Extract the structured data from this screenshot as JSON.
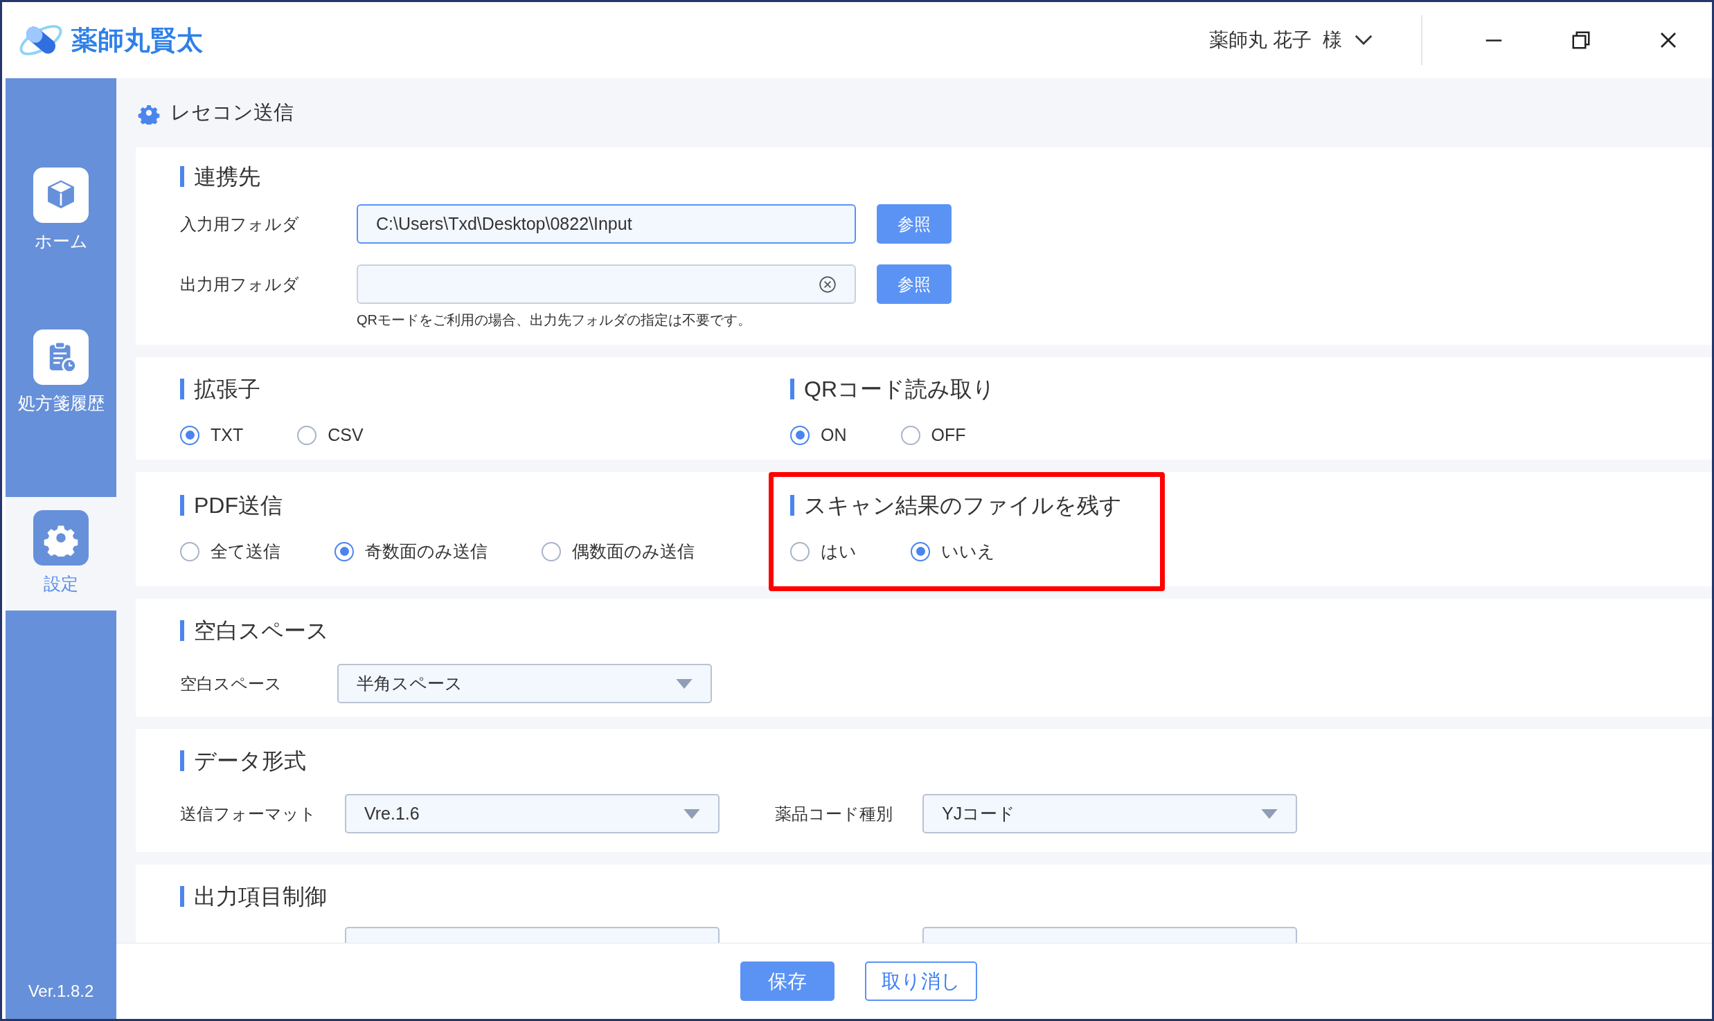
{
  "app": {
    "name": "薬師丸賢太"
  },
  "user": {
    "name": "薬師丸 花子",
    "honorific": "様"
  },
  "sidebar": {
    "items": [
      {
        "kind": "home",
        "label": "ホーム",
        "selected": false
      },
      {
        "kind": "history",
        "label": "処方箋履歴",
        "selected": false
      },
      {
        "kind": "settings",
        "label": "設定",
        "selected": true
      }
    ],
    "version": "Ver.1.8.2"
  },
  "page_title": "レセコン送信",
  "cards": [
    {
      "kind": "folders",
      "title": "連携先",
      "fields": [
        {
          "label": "入力用フォルダ",
          "value": "C:\\Users\\Txd\\Desktop\\0822\\Input",
          "focused": true,
          "button": "参照"
        },
        {
          "label": "出力用フォルダ",
          "focused": false,
          "clearable": true,
          "button": "参照"
        }
      ],
      "note": "QRモードをご利用の場合、出力先フォルダの指定は不要です。"
    },
    {
      "kind": "radios",
      "groups": [
        {
          "title": "拡張子",
          "highlighted": false,
          "options": [
            {
              "label": "TXT",
              "selected": true
            },
            {
              "label": "CSV",
              "selected": false
            }
          ]
        },
        {
          "title": "QRコード読み取り",
          "highlighted": false,
          "options": [
            {
              "label": "ON",
              "selected": true
            },
            {
              "label": "OFF",
              "selected": false
            }
          ]
        }
      ]
    },
    {
      "kind": "radios",
      "groups": [
        {
          "title": "PDF送信",
          "highlighted": false,
          "options": [
            {
              "label": "全て送信",
              "selected": false
            },
            {
              "label": "奇数面のみ送信",
              "selected": true
            },
            {
              "label": "偶数面のみ送信",
              "selected": false
            }
          ]
        },
        {
          "title": "スキャン結果のファイルを残す",
          "highlighted": true,
          "options": [
            {
              "label": "はい",
              "selected": false
            },
            {
              "label": "いいえ",
              "selected": true
            }
          ]
        }
      ]
    },
    {
      "kind": "selects",
      "title": "空白スペース",
      "fields": [
        {
          "label": "空白スペース",
          "value": "半角スペース"
        }
      ]
    },
    {
      "kind": "selects",
      "title": "データ形式",
      "fields": [
        {
          "label": "送信フォーマット",
          "value": "Vre.1.6"
        },
        {
          "label": "薬品コード種別",
          "value": "YJコード"
        }
      ]
    },
    {
      "kind": "clipped",
      "title": "出力項目制御",
      "fields": [
        {
          "kind": "dropdown"
        },
        {
          "kind": "dropdown"
        }
      ]
    }
  ],
  "footer": {
    "buttons": [
      {
        "kind": "primary",
        "label": "保存"
      },
      {
        "kind": "secondary",
        "label": "取り消し"
      }
    ]
  }
}
